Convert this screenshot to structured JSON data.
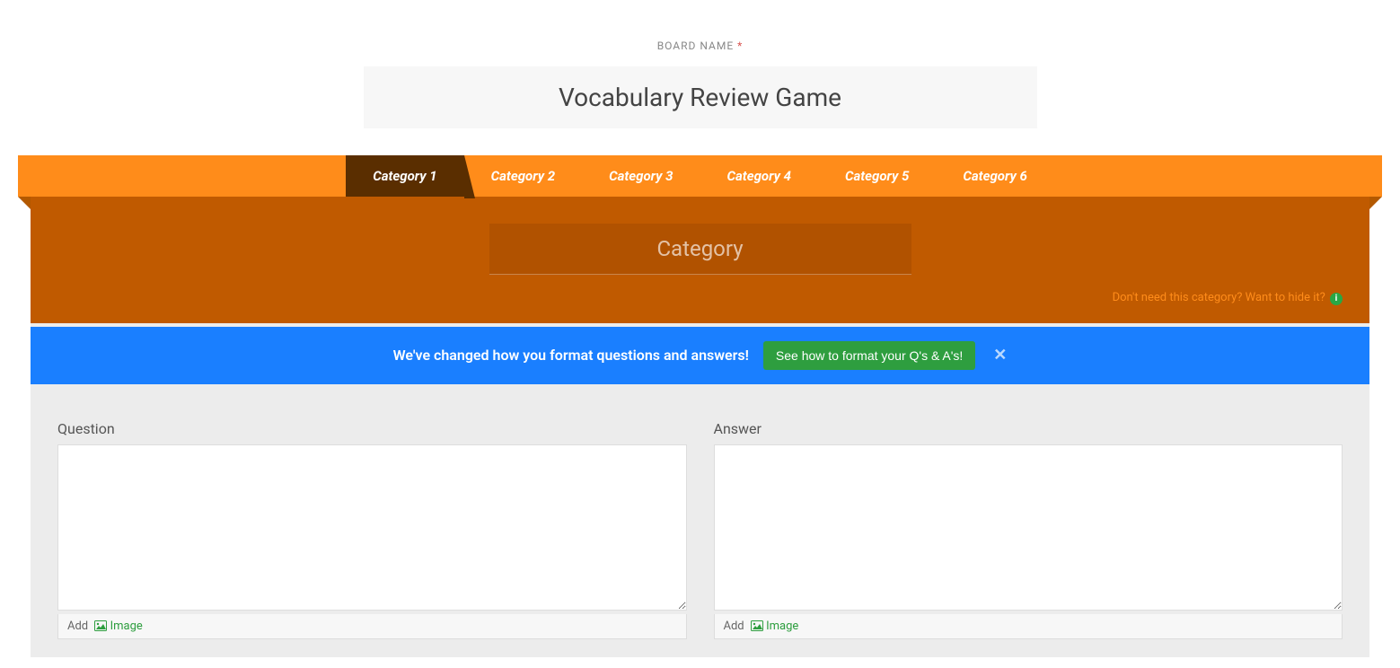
{
  "boardName": {
    "label": "BOARD NAME",
    "required": "*",
    "value": "Vocabulary Review Game"
  },
  "tabs": [
    {
      "label": "Category 1",
      "active": true
    },
    {
      "label": "Category 2",
      "active": false
    },
    {
      "label": "Category 3",
      "active": false
    },
    {
      "label": "Category 4",
      "active": false
    },
    {
      "label": "Category 5",
      "active": false
    },
    {
      "label": "Category 6",
      "active": false
    }
  ],
  "categoryPanel": {
    "placeholder": "Category",
    "value": "",
    "hideLink": "Don't need this category? Want to hide it?"
  },
  "alert": {
    "text": "We've changed how you format questions and answers!",
    "buttonLabel": "See how to format your Q's & A's!"
  },
  "qa": {
    "questionLabel": "Question",
    "answerLabel": "Answer",
    "addLabel": "Add",
    "imageLabel": "Image"
  }
}
